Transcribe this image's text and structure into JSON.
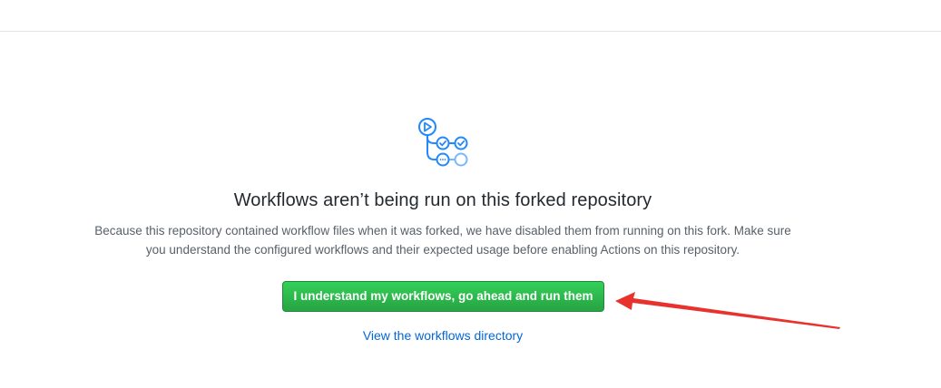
{
  "empty_state": {
    "icon": "actions-workflow-icon",
    "title": "Workflows aren’t being run on this forked repository",
    "description_line1": "Because this repository contained workflow files when it was forked, we have disabled them from running on this fork. Make sure",
    "description_line2": "you understand the configured workflows and their expected usage before enabling Actions on this repository.",
    "enable_button_label": "I understand my workflows, go ahead and run them",
    "directory_link_label": "View the workflows directory"
  },
  "colors": {
    "icon_blue": "#2188ff",
    "icon_light_blue": "#79b8ff",
    "button_green": "#28a745",
    "link_blue": "#0366d6",
    "annotation_red": "#e8322d"
  }
}
